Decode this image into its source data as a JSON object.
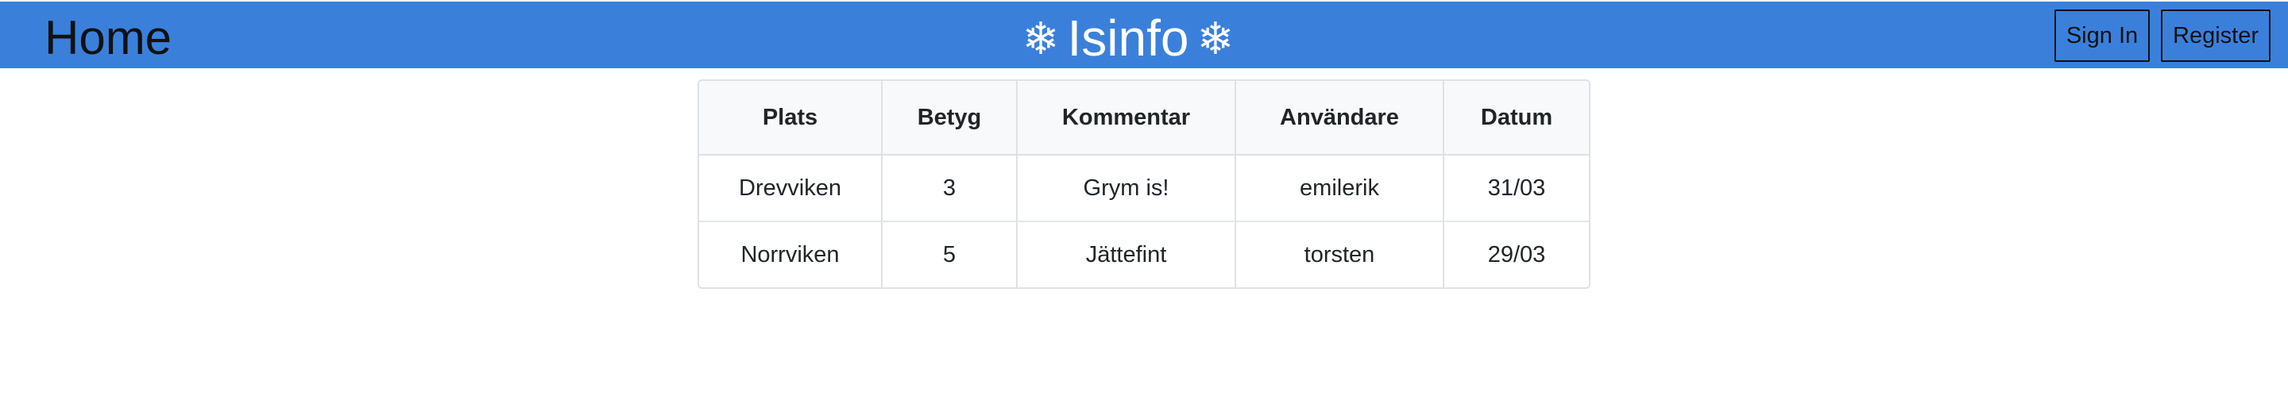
{
  "navbar": {
    "home_label": "Home",
    "brand": {
      "left_icon": "❄",
      "title": "Isinfo",
      "right_icon": "❄"
    },
    "sign_in_label": "Sign In",
    "register_label": "Register",
    "colors": {
      "background": "#3a80db",
      "brand_text": "#ffffff"
    }
  },
  "table": {
    "headers": [
      "Plats",
      "Betyg",
      "Kommentar",
      "Användare",
      "Datum"
    ],
    "rows": [
      [
        "Drevviken",
        "3",
        "Grym is!",
        "emilerik",
        "31/03"
      ],
      [
        "Norrviken",
        "5",
        "Jättefint",
        "torsten",
        "29/03"
      ]
    ]
  }
}
